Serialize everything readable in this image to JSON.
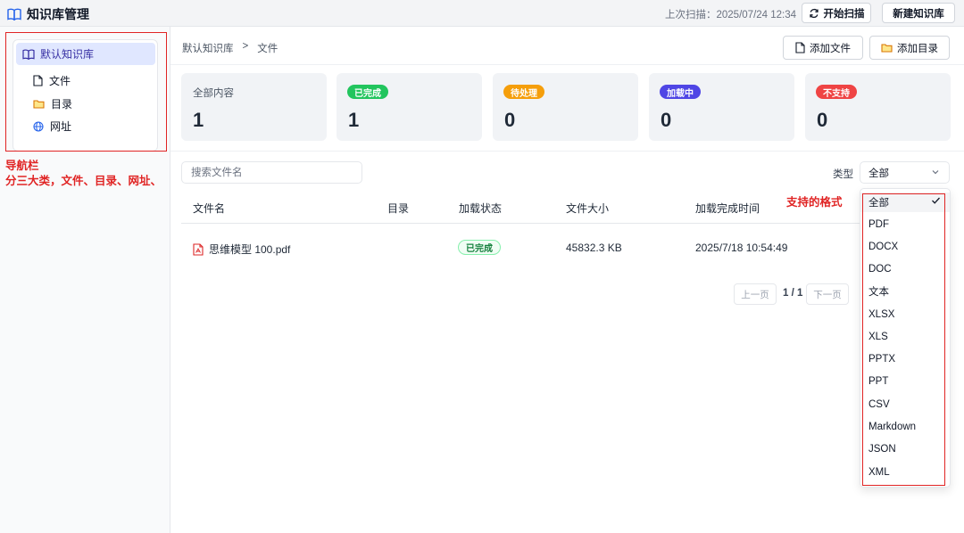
{
  "header": {
    "title": "知识库管理",
    "last_scan": "上次扫描：2025/07/24 12:34",
    "scan_button": "开始扫描",
    "new_kb_button": "新建知识库"
  },
  "sidebar": {
    "root": "默认知识库",
    "items": [
      {
        "label": "文件",
        "icon": "file-icon"
      },
      {
        "label": "目录",
        "icon": "folder-icon"
      },
      {
        "label": "网址",
        "icon": "globe-icon"
      }
    ]
  },
  "annotations": {
    "nav_line1": "导航栏",
    "nav_line2": "分三大类，文件、目录、网址、",
    "formats": "支持的格式"
  },
  "breadcrumb": {
    "root": "默认知识库",
    "separator": ">",
    "current": "文件"
  },
  "toolbar": {
    "add_file": "添加文件",
    "add_dir": "添加目录"
  },
  "stats": [
    {
      "label": "全部内容",
      "value": "1",
      "color": ""
    },
    {
      "label": "已完成",
      "value": "1",
      "color": "#22c55e"
    },
    {
      "label": "待处理",
      "value": "0",
      "color": "#f59e0b"
    },
    {
      "label": "加载中",
      "value": "0",
      "color": "#4f46e5"
    },
    {
      "label": "不支持",
      "value": "0",
      "color": "#ef4444"
    }
  ],
  "filter": {
    "search_placeholder": "搜索文件名",
    "type_label": "类型",
    "type_selected": "全部"
  },
  "table": {
    "columns": [
      "文件名",
      "目录",
      "加载状态",
      "文件大小",
      "加载完成时间"
    ],
    "rows": [
      {
        "name": "思维模型 100.pdf",
        "dir": "",
        "status": "已完成",
        "size": "45832.3 KB",
        "time": "2025/7/18 10:54:49"
      }
    ]
  },
  "pager": {
    "prev": "上一页",
    "info": "1 / 1",
    "next": "下一页"
  },
  "dropdown": {
    "options": [
      "全部",
      "PDF",
      "DOCX",
      "DOC",
      "文本",
      "XLSX",
      "XLS",
      "PPTX",
      "PPT",
      "CSV",
      "Markdown",
      "JSON",
      "XML"
    ],
    "selected_index": 0
  }
}
